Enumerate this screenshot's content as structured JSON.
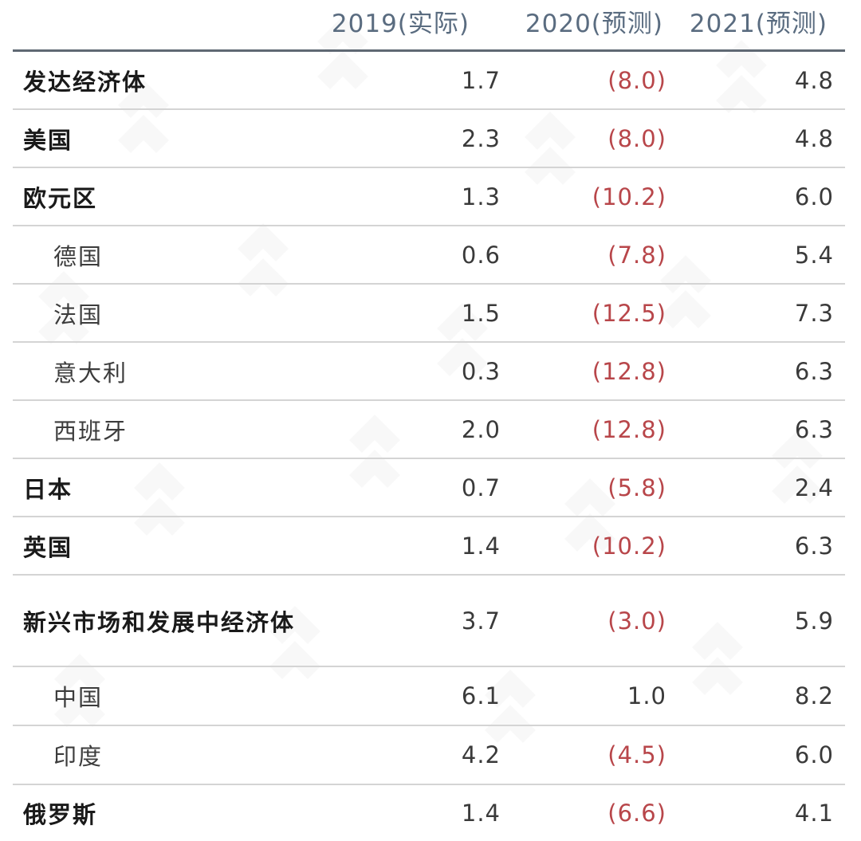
{
  "colors": {
    "header_text": "#5a6c80",
    "header_rule": "#5f6873",
    "row_rule": "#d4d4d4",
    "negative": "#b8464a",
    "text": "#3a3a3a"
  },
  "header": {
    "col_2019": "2019(实际)",
    "col_2020": "2020(预测)",
    "col_2021": "2021(预测)"
  },
  "rows": [
    {
      "name": "发达经济体",
      "v2019": "1.7",
      "v2020": "(8.0)",
      "v2021": "4.8"
    },
    {
      "name": "美国",
      "v2019": "2.3",
      "v2020": "(8.0)",
      "v2021": "4.8"
    },
    {
      "name": "欧元区",
      "v2019": "1.3",
      "v2020": "(10.2)",
      "v2021": "6.0"
    },
    {
      "name": "德国",
      "v2019": "0.6",
      "v2020": "(7.8)",
      "v2021": "5.4"
    },
    {
      "name": "法国",
      "v2019": "1.5",
      "v2020": "(12.5)",
      "v2021": "7.3"
    },
    {
      "name": "意大利",
      "v2019": "0.3",
      "v2020": "(12.8)",
      "v2021": "6.3"
    },
    {
      "name": "西班牙",
      "v2019": "2.0",
      "v2020": "(12.8)",
      "v2021": "6.3"
    },
    {
      "name": "日本",
      "v2019": "0.7",
      "v2020": "(5.8)",
      "v2021": "2.4"
    },
    {
      "name": "英国",
      "v2019": "1.4",
      "v2020": "(10.2)",
      "v2021": "6.3"
    },
    {
      "name": "新兴市场和发展中经济体",
      "v2019": "3.7",
      "v2020": "(3.0)",
      "v2021": "5.9"
    },
    {
      "name": "中国",
      "v2019": "6.1",
      "v2020": "1.0",
      "v2021": "8.2"
    },
    {
      "name": "印度",
      "v2019": "4.2",
      "v2020": "(4.5)",
      "v2021": "6.0"
    },
    {
      "name": "俄罗斯",
      "v2019": "1.4",
      "v2020": "(6.6)",
      "v2021": "4.1"
    }
  ]
}
